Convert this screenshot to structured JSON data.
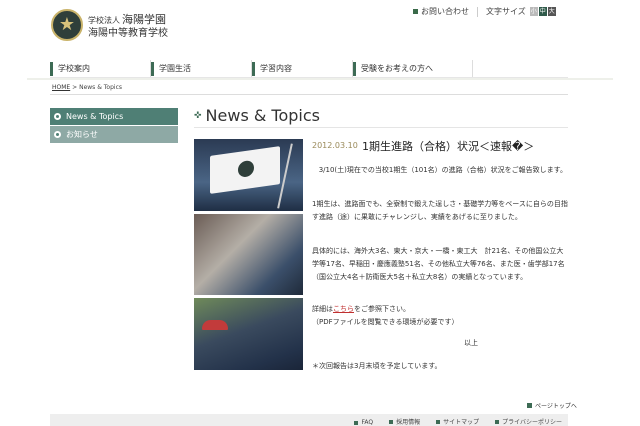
{
  "header": {
    "school_corp": "学校法人",
    "school_corp_name": "海陽学園",
    "school_name": "海陽中等教育学校",
    "contact": "お問い合わせ",
    "font_size_label": "文字サイズ",
    "font_sizes": [
      "小",
      "中",
      "大"
    ]
  },
  "nav": {
    "items": [
      "学校案内",
      "学園生活",
      "学習内容",
      "受験をお考えの方へ"
    ]
  },
  "breadcrumb": {
    "home": "HOME",
    "sep": ">",
    "current": "News & Topics"
  },
  "sidebar": {
    "items": [
      {
        "label": "News & Topics",
        "active": true
      },
      {
        "label": "お知らせ",
        "active": false
      }
    ]
  },
  "main": {
    "title": "News & Topics",
    "date": "2012.03.10",
    "headline": "1期生進路（合格）状況＜速報�＞",
    "p1": "3/10(土)現在での当校1期生（101名）の進路（合格）状況をご報告致します。",
    "p2": "1期生は、進路面でも、全寮制で鍛えた逞しさ・基礎学力等をベースに自らの目指す進路（途）に果敢にチャレンジし、実績をあげるに至りました。",
    "p3": "具体的には、海外大3名、東大・京大・一橋・東工大　計21名、その他国公立大学等17名、早稲田・慶應義塾51名、その他私立大等76名、また医・歯学部17名（国公立大4名＋防衛医大5名＋私立大8名）の実績となっています。",
    "p4_pre": "詳細は",
    "p4_link": "こちら",
    "p4_post": "をご参照下さい。",
    "p4_note": "（PDFファイルを閲覧できる環境が必要です）",
    "p5": "以上",
    "p6": "＊次回報告は3月末頃を予定しています。"
  },
  "pagetop": "ページトップへ",
  "footer": {
    "links": [
      "FAQ",
      "採用情報",
      "サイトマップ",
      "プライバシーポリシー"
    ]
  },
  "colors": {
    "accent": "#3d6b55",
    "sidebar_active": "#4f7f75",
    "sidebar_item": "#8ea9a5",
    "date": "#9a8a5a",
    "link": "#c03030"
  }
}
